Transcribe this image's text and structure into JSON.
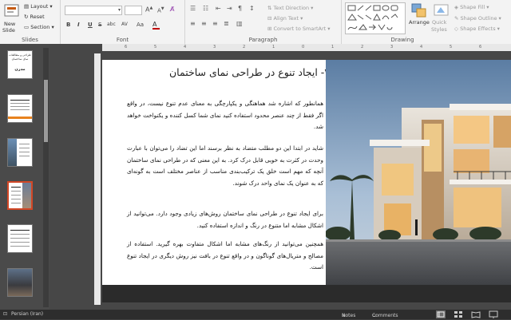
{
  "ribbon": {
    "slides_group": {
      "label": "Slides",
      "new_slide": "New",
      "new_slide2": "Slide",
      "layout": "Layout",
      "reset": "Reset",
      "section": "Section"
    },
    "font_group": {
      "label": "Font",
      "bold": "B",
      "italic": "I",
      "underline": "U",
      "strike": "S",
      "shadow": "abc",
      "spacing": "AV"
    },
    "paragraph_group": {
      "label": "Paragraph",
      "text_direction": "Text Direction",
      "align_text": "Align Text",
      "convert_smartart": "Convert to SmartArt"
    },
    "drawing_group": {
      "label": "Drawing",
      "arrange": "Arrange",
      "quick_styles": "Quick",
      "quick_styles2": "Styles",
      "shape_fill": "Shape Fill",
      "shape_outline": "Shape Outline",
      "shape_effects": "Shape Effects"
    }
  },
  "ruler_ticks": [
    "6",
    "5",
    "4",
    "3",
    "2",
    "1",
    "0",
    "1",
    "2",
    "3",
    "4",
    "5",
    "6"
  ],
  "thumbnails": [
    {
      "num": "1",
      "title": "طراحی و مطالعات نمای ساختمان",
      "subtitle": "مدرن"
    },
    {
      "num": "2"
    },
    {
      "num": "3"
    },
    {
      "num": "4"
    },
    {
      "num": "5"
    },
    {
      "num": "6"
    }
  ],
  "slide": {
    "title": "۲- ایجاد تنوع در طراحی نمای ساختمان",
    "paragraph1": "همانطور که اشاره شد هماهنگی و یکپارچگی به معنای عدم تنوع نیست، در واقع اگر فقط از چند عنصر محدود استفاده کنید نمای شما کسل کننده و یکنواخت خواهد شد.",
    "paragraph2": "شاید در ابتدا این دو مطلب متضاد به نظر برسند اما این تضاد را می‌توان با عبارت وحدت در کثرت به خوبی قابل درک کرد. به این معنی که در طراحی نمای ساختمان آنچه که مهم است خلق یک ترکیب‌بندی مناسب از عناصر مختلف است به گونه‌ای که به عنوان یک نمای واحد درک شوند.",
    "paragraph3a": "برای ایجاد تنوع در طراحی نمای ساختمان روش‌های زیادی وجود دارد. می‌توانید از اشکال مشابه اما متنوع در رنگ و اندازه استفاده کنید.",
    "paragraph3b": "همچنین می‌توانید از رنگ‌های مشابه اما اشکال متفاوت بهره گیرید. استفاده از مصالح و متریال‌های گوناگون و در واقع تنوع در بافت نیز روش دیگری در ایجاد تنوع است."
  },
  "statusbar": {
    "language": "Persian (Iran)",
    "notes": "Notes",
    "comments": "Comments"
  }
}
